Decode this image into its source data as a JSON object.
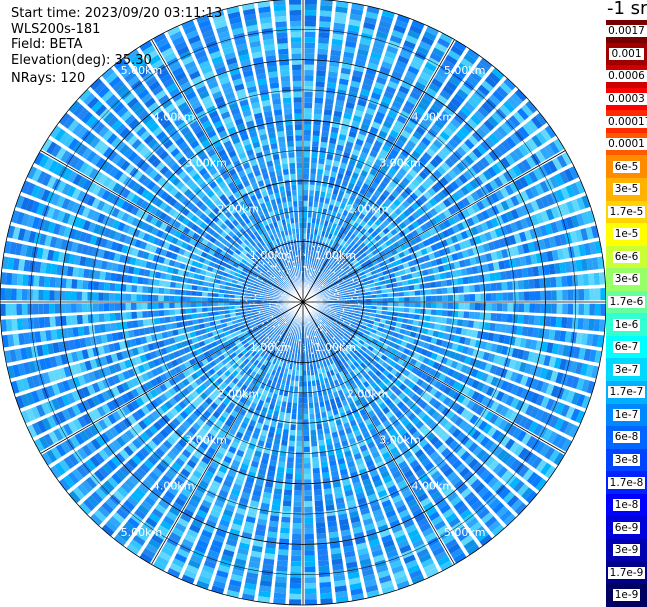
{
  "plot_info": {
    "start_time": "Start time: 2023/09/20 03:11:13",
    "device": "WLS200s-181",
    "field": "Field: BETA",
    "elevation": "Elevation(deg): 35.30",
    "nrays": "NRays: 120"
  },
  "colorbar": {
    "unit": "-1 sr",
    "labels": [
      "0.0017",
      "0.001",
      "0.0006",
      "0.0003",
      "0.00017",
      "0.0001",
      "6e-5",
      "3e-5",
      "1.7e-5",
      "1e-5",
      "6e-6",
      "3e-6",
      "1.7e-6",
      "1e-6",
      "6e-7",
      "3e-7",
      "1.7e-7",
      "1e-7",
      "6e-8",
      "3e-8",
      "1.7e-8",
      "1e-8",
      "6e-9",
      "3e-9",
      "1.7e-9",
      "1e-9"
    ],
    "colors": [
      "#7a0000",
      "#a00000",
      "#cc0000",
      "#ff0000",
      "#ff2a00",
      "#ff5a00",
      "#ff8c00",
      "#ffb300",
      "#ffd400",
      "#ffff00",
      "#ccff33",
      "#99ff66",
      "#66ffa0",
      "#33ffd2",
      "#00ffff",
      "#00d8ff",
      "#00b0ff",
      "#0088ff",
      "#0066ff",
      "#0044ff",
      "#0022ff",
      "#0000ff",
      "#0000d8",
      "#0000b0",
      "#000088",
      "#000060"
    ]
  },
  "chart_data": {
    "type": "ppi-polar",
    "nrays": 120,
    "elevation_deg": 35.3,
    "range_rings_km": [
      1.0,
      2.0,
      3.0,
      4.0,
      5.0
    ],
    "range_labels": [
      "1.00km",
      "2.00km",
      "3.00km",
      "4.00km",
      "5.00km"
    ],
    "spokes_deg": [
      0,
      30,
      60,
      90,
      120,
      150,
      180,
      210,
      240,
      270,
      300,
      330
    ],
    "max_range_km": 5.0,
    "value_range": [
      "1e-9",
      "0.0017"
    ],
    "dominant_levels": [
      "6e-8",
      "3e-8",
      "1.7e-8",
      "1.7e-7",
      "3e-7"
    ]
  }
}
